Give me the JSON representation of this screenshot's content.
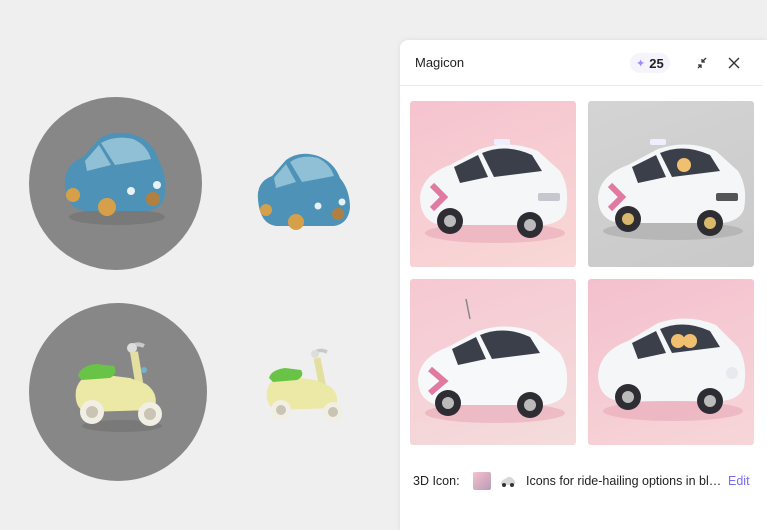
{
  "panel": {
    "title": "Magicon",
    "credits": "25",
    "footer": {
      "label": "3D Icon:",
      "prompt": "Icons for ride-hailing options in bla…",
      "edit_label": "Edit"
    }
  },
  "canvas": {
    "items": [
      "blue-car-3d",
      "blue-car-3d-cutout",
      "scooter-3d",
      "scooter-3d-cutout"
    ]
  },
  "results": [
    "taxi-variant-1",
    "taxi-variant-2",
    "taxi-variant-3",
    "taxi-variant-4"
  ],
  "colors": {
    "accent": "#7a6cf0",
    "circle_bg": "#878787",
    "car_blue": "#4e93b7",
    "scooter_yellow": "#ece8a6",
    "scooter_green": "#69c347",
    "thumb_pink": "#f6c8d2"
  }
}
